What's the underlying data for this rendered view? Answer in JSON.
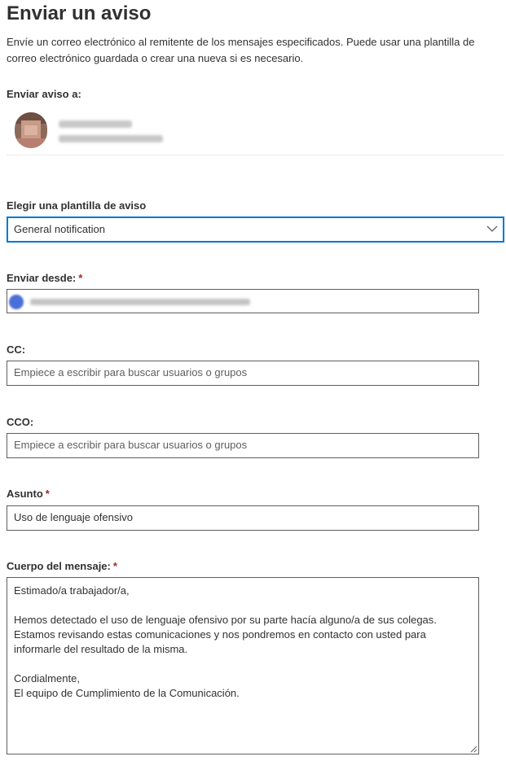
{
  "title": "Enviar un aviso",
  "description": "Envíe un correo electrónico al remitente de los mensajes especificados. Puede usar una plantilla de correo electrónico guardada o crear una nueva si es necesario.",
  "send_to": {
    "label": "Enviar aviso a:"
  },
  "template": {
    "label": "Elegir una plantilla de aviso",
    "selected": "General notification",
    "icon": "chevron-down-icon"
  },
  "from": {
    "label": "Enviar desde:",
    "required_mark": "*"
  },
  "cc": {
    "label": "CC:",
    "placeholder": "Empiece a escribir para buscar usuarios o grupos"
  },
  "bcc": {
    "label": "CCO:",
    "placeholder": "Empiece a escribir para buscar usuarios o grupos"
  },
  "subject": {
    "label": "Asunto",
    "required_mark": "*",
    "value": "Uso de lenguaje ofensivo"
  },
  "body": {
    "label": "Cuerpo del mensaje:",
    "required_mark": "*",
    "lines": [
      "Estimado/a trabajador/a,",
      "",
      "Hemos detectado el uso de lenguaje ofensivo por su parte hacía alguno/a de sus colegas.",
      "Estamos revisando estas comunicaciones y nos pondremos en contacto con usted para",
      "informarle del resultado de la misma.",
      "",
      "Cordialmente,",
      "El equipo de Cumplimiento de la Comunicación."
    ]
  },
  "colors": {
    "accent": "#0078d4",
    "required": "#a4262c",
    "text": "#323130"
  }
}
